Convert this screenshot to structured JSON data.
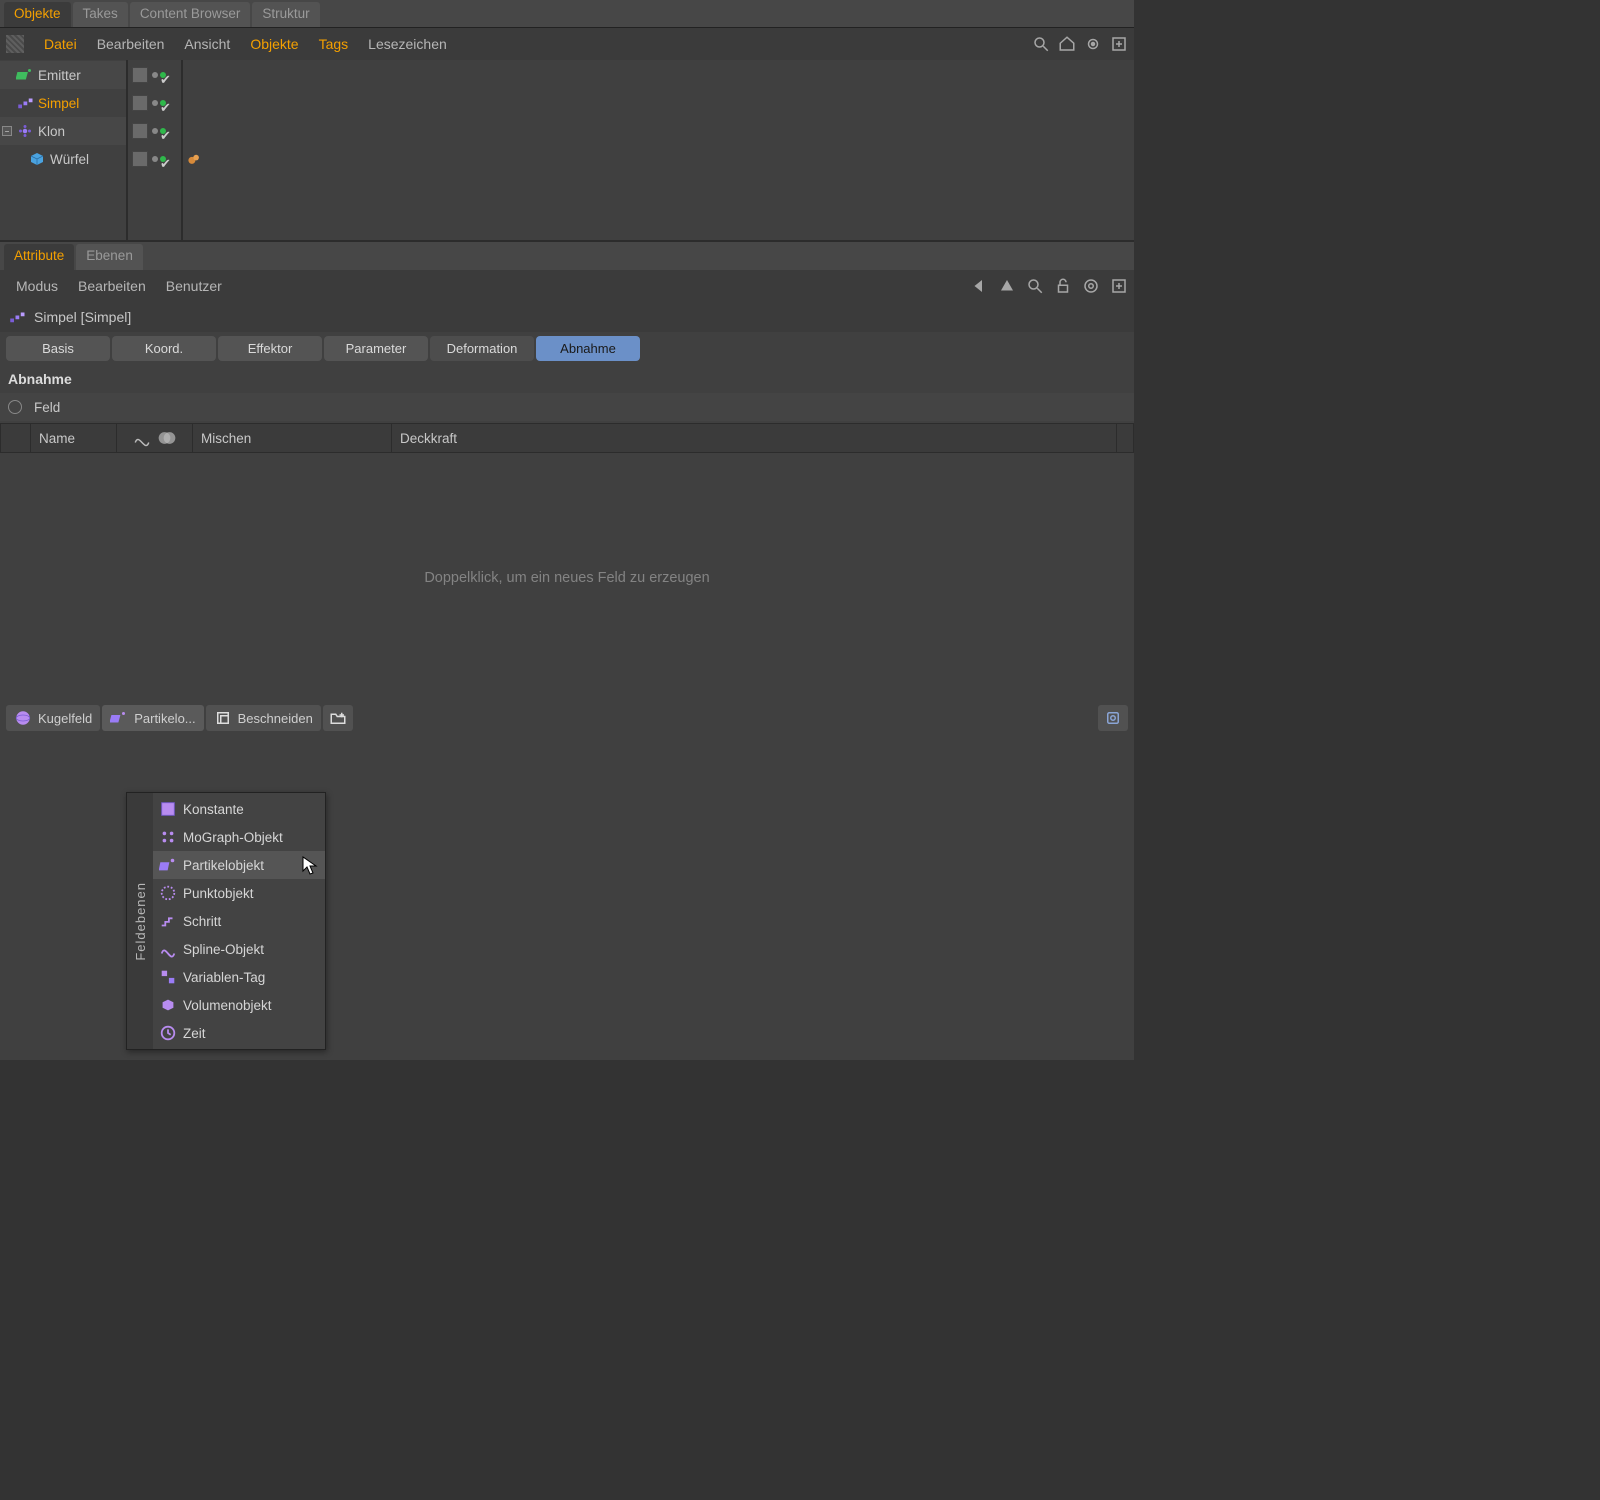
{
  "topTabs": {
    "tab0": "Objekte",
    "tab1": "Takes",
    "tab2": "Content Browser",
    "tab3": "Struktur"
  },
  "objMenu": {
    "m0": "Datei",
    "m1": "Bearbeiten",
    "m2": "Ansicht",
    "m3": "Objekte",
    "m4": "Tags",
    "m5": "Lesezeichen"
  },
  "tree": {
    "r0": "Emitter",
    "r1": "Simpel",
    "r2": "Klon",
    "r3": "Würfel"
  },
  "attrTabs": {
    "t0": "Attribute",
    "t1": "Ebenen"
  },
  "attrMenu": {
    "m0": "Modus",
    "m1": "Bearbeiten",
    "m2": "Benutzer"
  },
  "objHeader": "Simpel [Simpel]",
  "aTabs": {
    "t0": "Basis",
    "t1": "Koord.",
    "t2": "Effektor",
    "t3": "Parameter",
    "t4": "Deformation",
    "t5": "Abnahme"
  },
  "abnahme": "Abnahme",
  "feldLabel": "Feld",
  "gridHeaders": {
    "h2": "Name",
    "h4": "Mischen",
    "h5": "Deckkraft"
  },
  "emptyText": "Doppelklick, um ein neues Feld zu erzeugen",
  "btmBtns": {
    "b0": "Kugelfeld",
    "b1": "Partikelo...",
    "b2": "Beschneiden"
  },
  "popup": {
    "side": "Feldebenen",
    "items": {
      "i0": "Konstante",
      "i1": "MoGraph-Objekt",
      "i2": "Partikelobjekt",
      "i3": "Punktobjekt",
      "i4": "Schritt",
      "i5": "Spline-Objekt",
      "i6": "Variablen-Tag",
      "i7": "Volumenobjekt",
      "i8": "Zeit"
    }
  }
}
